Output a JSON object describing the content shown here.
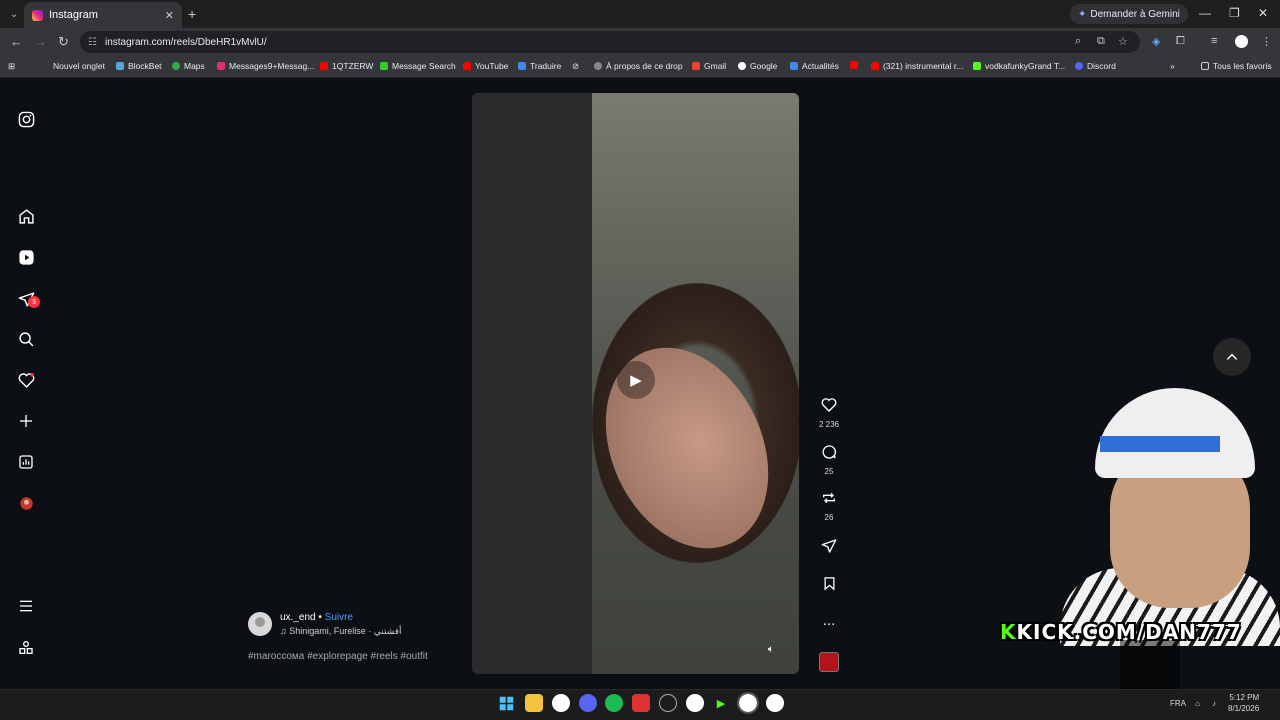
{
  "browser": {
    "tab_title": "Instagram",
    "new_tab_symbol": "+",
    "gemini_label": "Demander à Gemini",
    "url": "instagram.com/reels/DbeHR1vMvlU/",
    "bookmarks": [
      "Nouvel onglet",
      "BlockBet",
      "Maps",
      "Messages9+Messag...",
      "1QTZERW",
      "Message Search",
      "YouTube",
      "Traduire",
      "À propos de ce drop",
      "Gmail",
      "Google",
      "Actualités",
      "(321) instrumental r...",
      "vodkafunkyGrand T...",
      "Discord"
    ],
    "all_bookmarks_label": "Tous les favoris",
    "more_symbol": "»"
  },
  "sidebar": {
    "messages_badge": "3"
  },
  "reel": {
    "username": "ux._end",
    "separator": " • ",
    "follow_label": "Suivre",
    "audio": "♫ Shinigami, Furelise · أفشتني",
    "hashtags": "#maroccoма #explorepage #reels #outfit",
    "likes": "2 236",
    "comments": "25",
    "reposts": "26",
    "more": "..."
  },
  "stream_overlay": {
    "kick_prefix": "K",
    "kick_text": "KICK.COM/",
    "kick_channel": "DAN777"
  },
  "taskbar": {
    "lang": "FRA",
    "time": "5:12 PM",
    "date": "8/1/2026"
  }
}
